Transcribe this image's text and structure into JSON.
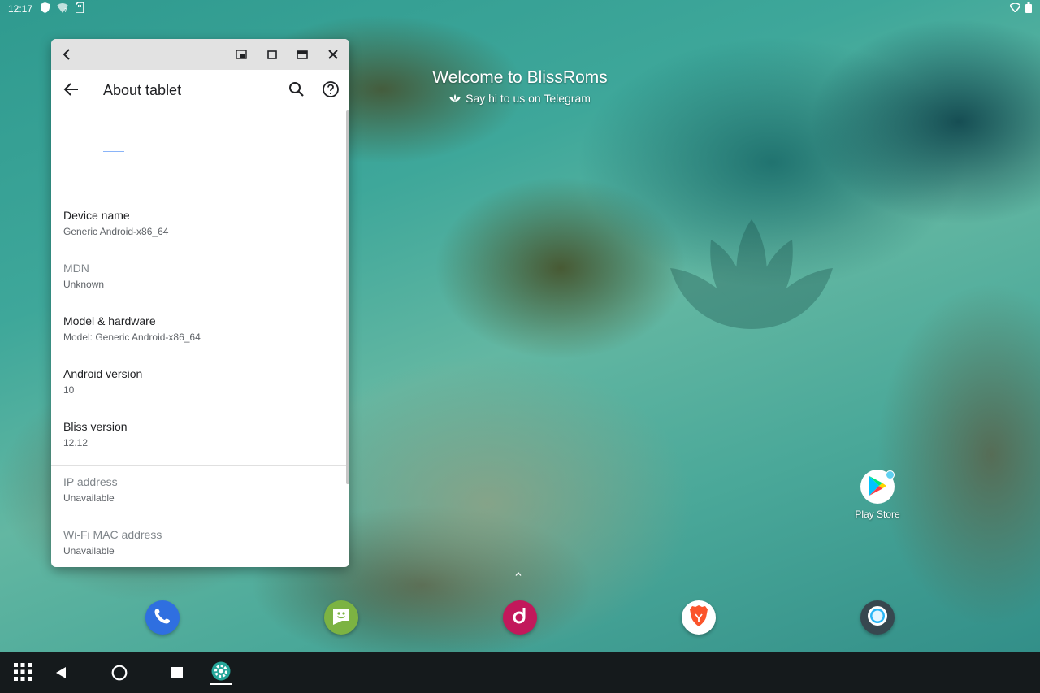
{
  "status_bar": {
    "time": "12:17"
  },
  "welcome": {
    "title": "Welcome to BlissRoms",
    "subtitle": "Say hi to us on Telegram"
  },
  "settings_window": {
    "title": "About tablet",
    "items": [
      {
        "title": "Device name",
        "summary": "Generic Android-x86_64",
        "enabled": true
      },
      {
        "title": "MDN",
        "summary": "Unknown",
        "enabled": false
      },
      {
        "title": "Model & hardware",
        "summary": "Model: Generic Android-x86_64",
        "enabled": true
      },
      {
        "title": "Android version",
        "summary": "10",
        "enabled": true
      },
      {
        "title": "Bliss version",
        "summary": "12.12",
        "enabled": true
      },
      {
        "title": "IP address",
        "summary": "Unavailable",
        "enabled": false
      },
      {
        "title": "Wi-Fi MAC address",
        "summary": "Unavailable",
        "enabled": false
      }
    ]
  },
  "desktop": {
    "play_store_label": "Play Store"
  },
  "dock": {
    "apps": [
      "phone-icon",
      "messaging-icon",
      "music-icon",
      "brave-browser-icon",
      "camera-icon"
    ]
  },
  "taskbar": {
    "items": [
      "app-drawer-icon",
      "back-icon",
      "home-icon",
      "recents-icon",
      "settings-icon"
    ]
  },
  "colors": {
    "accent": "#1a73e8",
    "taskbar": "#151a1c",
    "caption": "#e2e2e2"
  }
}
